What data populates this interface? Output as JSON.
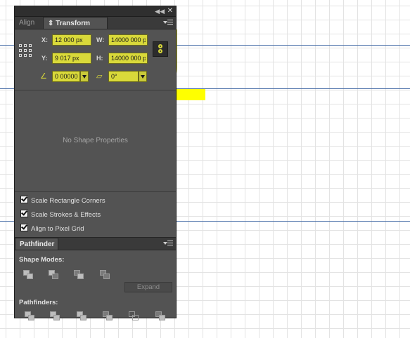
{
  "panel": {
    "tabs": [
      {
        "label": "Align"
      },
      {
        "label": "⇕ Transform",
        "active": true
      }
    ],
    "transform": {
      "x_label": "X:",
      "x_value": "12 000 px",
      "y_label": "Y:",
      "y_value": "9 017 px",
      "w_label": "W:",
      "w_value": "14000 000 p",
      "h_label": "H:",
      "h_value": "14000 000 p",
      "rotate_icon": "rotate-angle-icon",
      "rotate_value": "0 00000",
      "shear_icon": "shear-angle-icon",
      "shear_value": "0°"
    },
    "shape_properties_text": "No Shape Properties",
    "checkboxes": [
      {
        "label": "Scale Rectangle Corners",
        "checked": true
      },
      {
        "label": "Scale Strokes & Effects",
        "checked": true
      },
      {
        "label": "Align to Pixel Grid",
        "checked": true
      }
    ],
    "pathfinder": {
      "tab_label": "Pathfinder",
      "shape_modes_label": "Shape Modes:",
      "shape_modes": [
        "unite",
        "minus-front",
        "intersect",
        "exclude"
      ],
      "expand_label": "Expand",
      "pathfinders_label": "Pathfinders:",
      "pathfinders": [
        "divide",
        "trim",
        "merge",
        "crop",
        "outline",
        "minus-back"
      ]
    }
  },
  "colors": {
    "field_highlight": "#d9d93a",
    "panel_bg": "#535353",
    "guide": "#4a6fa8"
  }
}
